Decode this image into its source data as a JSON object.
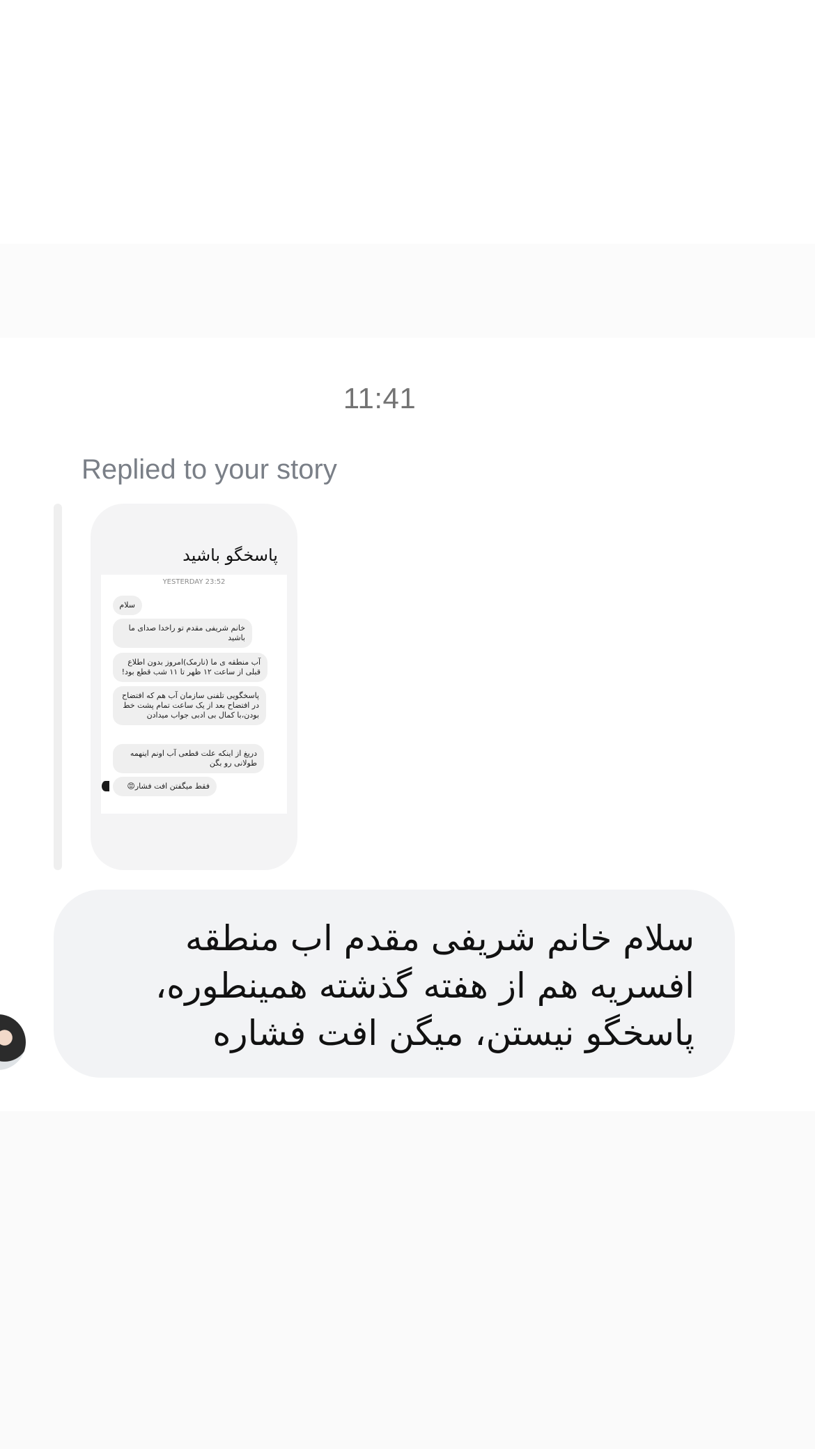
{
  "conversation": {
    "timestamp": "11:41",
    "reply_label": "Replied to your story"
  },
  "story": {
    "title": "پاسخگو باشید",
    "screenshot_date": "YESTERDAY 23:52",
    "messages": [
      "سلام",
      "خانم شریفی مقدم تو راخدا صدای ما باشید",
      "آب منطقه ی ما (نارمک)امروز بدون اطلاع قبلی از ساعت ۱۲ ظهر تا ۱۱ شب قطع بود!",
      "پاسخگویی تلفنی سازمان آب هم که افتضاح در افتضاح بعد از یک ساعت تمام پشت خط بودن،با کمال بی ادبی جواب میدادن",
      "دریغ از اینکه علت قطعی آب اونم اینهمه طولانی رو بگن",
      "فقط میگفتن افت فشار😡"
    ]
  },
  "message": {
    "text": "سلام خانم شریفی مقدم اب منطقه افسریه هم از هفته گذشته همینطوره، پاسخگو نیستن، میگن افت فشاره"
  },
  "icons": {
    "sender_avatar": "user-avatar-icon",
    "story_avatar": "mini-avatar-icon"
  }
}
